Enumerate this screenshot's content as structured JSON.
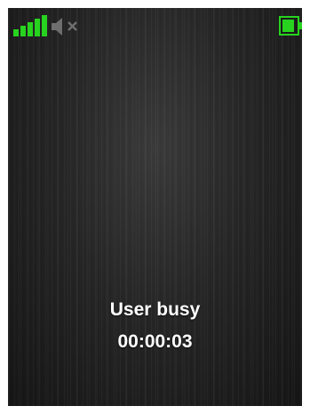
{
  "status_bar": {
    "signal_icon": "signal-strength-icon",
    "signal_bars": 5,
    "signal_color": "#27d31f",
    "mute_icon": "speaker-muted-icon",
    "mute_color": "#6e6e6e",
    "battery_icon": "battery-icon",
    "battery_color": "#27d31f",
    "battery_level": 0.85
  },
  "call": {
    "status": "User busy",
    "timer": "00:00:03"
  }
}
